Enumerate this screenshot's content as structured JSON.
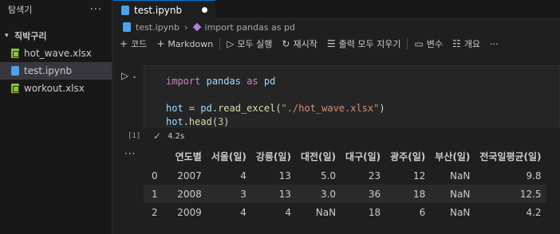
{
  "sidebar": {
    "title": "탐색기",
    "more": "···",
    "folder": "직박구리",
    "files": [
      {
        "name": "hot_wave.xlsx",
        "icon": "excel-file-icon"
      },
      {
        "name": "test.ipynb",
        "icon": "notebook-file-icon"
      },
      {
        "name": "workout.xlsx",
        "icon": "excel-file-icon"
      }
    ]
  },
  "tab": {
    "label": "test.ipynb"
  },
  "breadcrumb": {
    "file": "test.ipynb",
    "symbol": "import pandas as pd"
  },
  "toolbar": {
    "code": "코드",
    "markdown": "Markdown",
    "run_all": "모두 실행",
    "restart": "재시작",
    "clear_all": "출력 모두 지우기",
    "variables": "변수",
    "outline": "개요",
    "more": "···"
  },
  "cell": {
    "exec_count": "[1]",
    "duration": "4.2s",
    "code": {
      "l1_kw": "import",
      "l1_mod": "pandas",
      "l1_as": "as",
      "l1_alias": "pd",
      "l3_var": "hot",
      "l3_eq": " = ",
      "l3_pd": "pd",
      "l3_dot": ".",
      "l3_fn": "read_excel",
      "l3_open": "(",
      "l3_str": "\"./hot_wave.xlsx\"",
      "l3_close": ")",
      "l4_var": "hot",
      "l4_dot": ".",
      "l4_fn": "head",
      "l4_open": "(",
      "l4_num": "3",
      "l4_close": ")"
    }
  },
  "output": {
    "dots": "···",
    "columns": [
      "",
      "연도별",
      "서울(일)",
      "강릉(일)",
      "대전(일)",
      "대구(일)",
      "광주(일)",
      "부산(일)",
      "전국일평균(일)"
    ],
    "rows": [
      [
        "0",
        "2007",
        "4",
        "13",
        "5.0",
        "23",
        "12",
        "NaN",
        "9.8"
      ],
      [
        "1",
        "2008",
        "3",
        "13",
        "3.0",
        "36",
        "18",
        "NaN",
        "12.5"
      ],
      [
        "2",
        "2009",
        "4",
        "4",
        "NaN",
        "18",
        "6",
        "NaN",
        "4.2"
      ]
    ]
  }
}
